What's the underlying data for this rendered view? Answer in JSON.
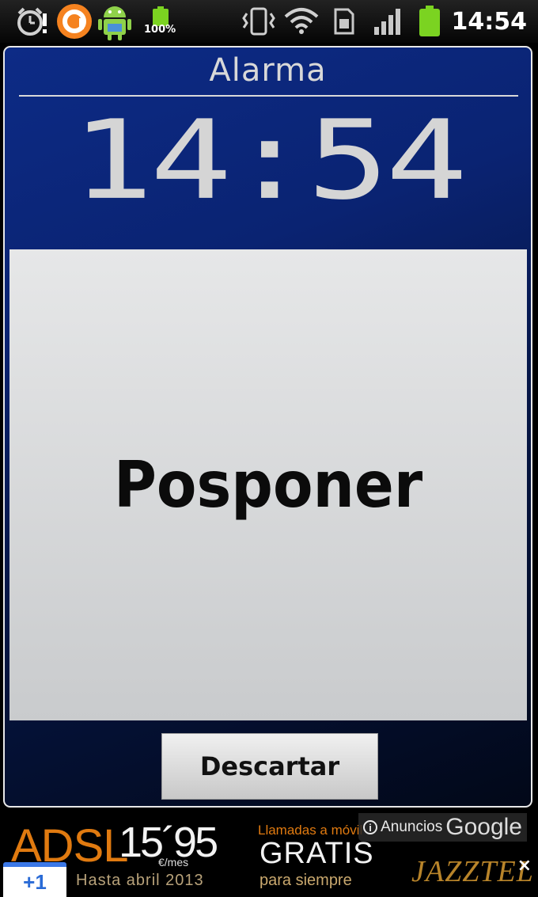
{
  "status_bar": {
    "time": "14:54",
    "battery_percent_label": "100%",
    "icons": [
      "alarm-clock-icon",
      "avast-icon",
      "android-icon",
      "battery-small-icon",
      "vibrate-icon",
      "wifi-icon",
      "sim-icon",
      "signal-icon",
      "battery-icon"
    ]
  },
  "dialog": {
    "title": "Alarma",
    "clock": "14:54",
    "snooze_label": "Posponer",
    "dismiss_label": "Descartar"
  },
  "ad": {
    "adsl": "ADSL",
    "price": "15´95",
    "per_month": "€/mes",
    "until": "Hasta abril 2013",
    "calls": "Llamadas a móvil",
    "free": "GRATIS",
    "forever": "para siempre",
    "brand": "JAZZTEL",
    "label": "Anuncios",
    "google": "Google",
    "close": "×",
    "plus_one": "+1"
  },
  "colors": {
    "dialog_blue": "#0a2372",
    "snooze_gray": "#d8d9da",
    "accent_orange": "#e07a10",
    "battery_green": "#7bd321"
  }
}
